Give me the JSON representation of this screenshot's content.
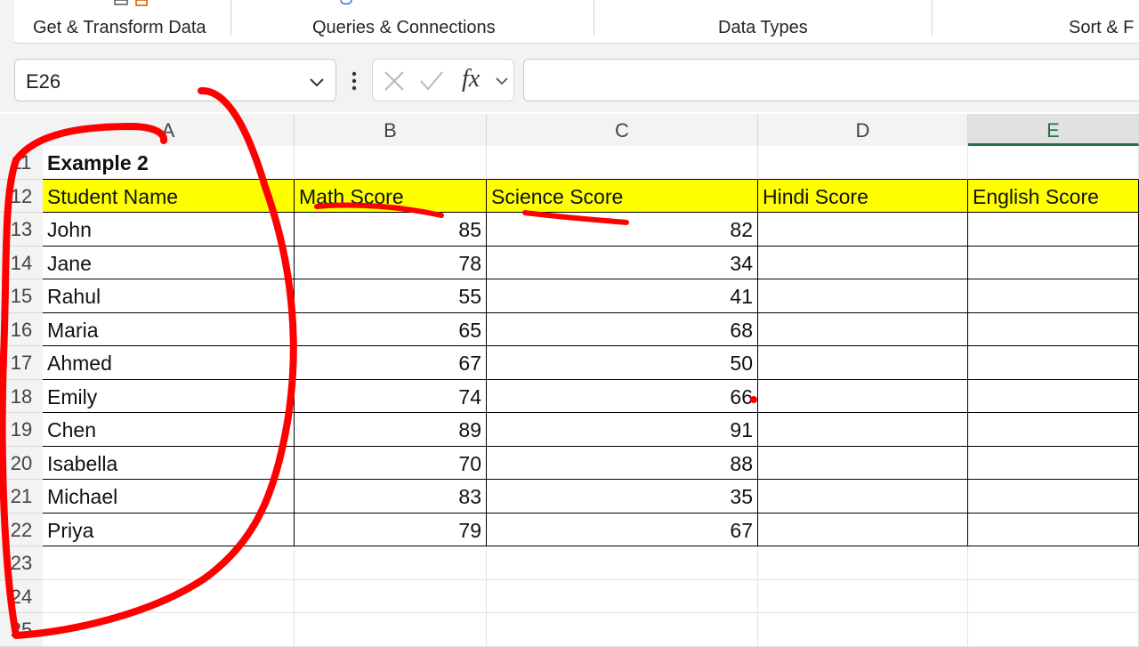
{
  "ribbon": {
    "groups": [
      "Get & Transform Data",
      "Queries & Connections",
      "Data Types",
      "Sort & F"
    ]
  },
  "formula_bar": {
    "name_box": "E26",
    "fx_label": "fx",
    "formula": ""
  },
  "sheet": {
    "columns": [
      "A",
      "B",
      "C",
      "D",
      "E"
    ],
    "active_column": "E",
    "rows": [
      "11",
      "12",
      "13",
      "14",
      "15",
      "16",
      "17",
      "18",
      "19",
      "20",
      "21",
      "22",
      "23",
      "24",
      "25"
    ],
    "title": "Example 2",
    "headers": [
      "Student Name",
      "Math Score",
      "Science Score",
      "Hindi Score",
      "English Score"
    ],
    "students": [
      {
        "name": "John",
        "math": "85",
        "science": "82"
      },
      {
        "name": "Jane",
        "math": "78",
        "science": "34"
      },
      {
        "name": "Rahul",
        "math": "55",
        "science": "41"
      },
      {
        "name": "Maria",
        "math": "65",
        "science": "68"
      },
      {
        "name": "Ahmed",
        "math": "67",
        "science": "50"
      },
      {
        "name": "Emily",
        "math": "74",
        "science": "66"
      },
      {
        "name": "Chen",
        "math": "89",
        "science": "91"
      },
      {
        "name": "Isabella",
        "math": "70",
        "science": "88"
      },
      {
        "name": "Michael",
        "math": "83",
        "science": "35"
      },
      {
        "name": "Priya",
        "math": "79",
        "science": "67"
      }
    ]
  },
  "colors": {
    "header_fill": "#ffff00",
    "annotation": "#ff0000",
    "excel_green": "#217346"
  }
}
